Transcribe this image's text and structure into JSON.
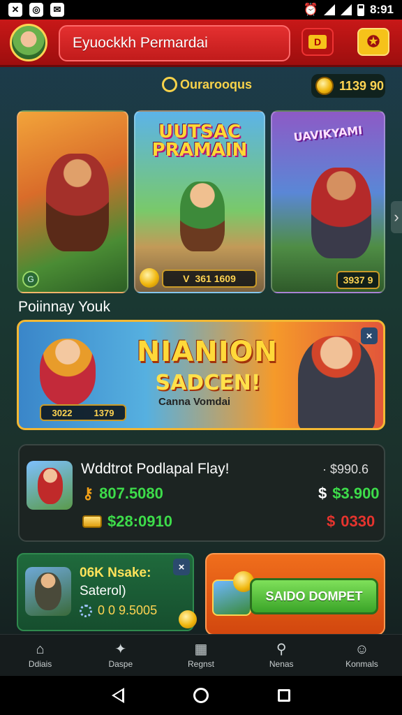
{
  "status_bar": {
    "time": "8:91",
    "left_icons": [
      "x-icon",
      "whatsapp-icon",
      "mail-icon"
    ],
    "right_icons": [
      "alarm-icon",
      "wifi-icon",
      "signal-icon",
      "battery-icon"
    ]
  },
  "header": {
    "search_text": "Eyuockkh Permardai",
    "button_one_label": "D",
    "button_two_label": "✪"
  },
  "section_top": {
    "label": "Ourarooqus",
    "coin_value": "1139 90"
  },
  "cards": [
    {
      "title": "",
      "badge": "G"
    },
    {
      "title_line1": "UUTSAC",
      "title_line2": "PRAMAIN",
      "bar_text": "361 1609",
      "bar_icon": "V"
    },
    {
      "title": "UAVIKYAMI",
      "bar_text": "3937 9"
    }
  ],
  "section_label": "Poiinnay Youk",
  "banner": {
    "title": "NIANION",
    "subtitle": "SADCEN!",
    "tagline": "Canna Vomdai",
    "bar_left": "3022",
    "bar_right": "1379",
    "close": "×"
  },
  "stats": {
    "title": "Wddtrot Podlapal Flay!",
    "right_top": "· $990.6",
    "row_a": "807.5080",
    "row_b": "$28:0910",
    "row_c": "$3.900",
    "row_d": "0330"
  },
  "promo": {
    "title": "06K Nsake:",
    "subtitle": "Saterol)",
    "value": "0 0 9.5005",
    "close": "×"
  },
  "wallet": {
    "button_label": "SAIDO DOMPET"
  },
  "bottom_nav": [
    {
      "label": "Ddiais",
      "icon": "home-icon"
    },
    {
      "label": "Daspe",
      "icon": "game-icon"
    },
    {
      "label": "Regnst",
      "icon": "calendar-icon"
    },
    {
      "label": "Nenas",
      "icon": "search-icon"
    },
    {
      "label": "Konmals",
      "icon": "profile-icon"
    }
  ],
  "colors": {
    "header_red": "#c81818",
    "accent_gold": "#f7d24a",
    "positive_green": "#3ddc4a",
    "negative_red": "#e6342e",
    "wallet_orange": "#f06e1c"
  }
}
